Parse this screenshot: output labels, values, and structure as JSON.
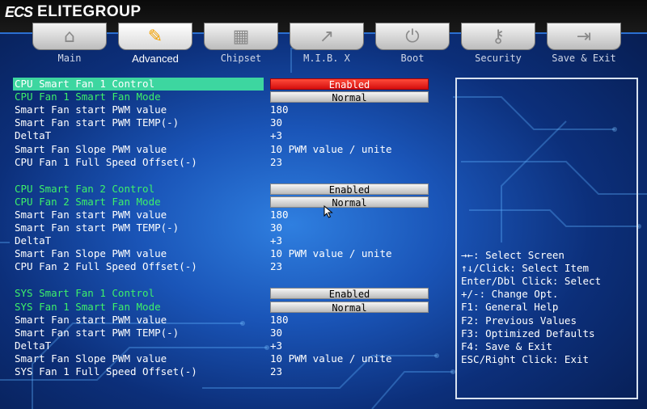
{
  "brand": {
    "logo": "ECS",
    "name": "ELITEGROUP"
  },
  "tabs": [
    {
      "label": "Main",
      "icon": "home-icon",
      "glyph": "⌂",
      "active": false
    },
    {
      "label": "Advanced",
      "icon": "wrench-icon",
      "glyph": "✎",
      "active": true
    },
    {
      "label": "Chipset",
      "icon": "chip-icon",
      "glyph": "▦",
      "active": false
    },
    {
      "label": "M.I.B. X",
      "icon": "chart-icon",
      "glyph": "↗",
      "active": false
    },
    {
      "label": "Boot",
      "icon": "power-icon",
      "glyph": "⏻",
      "active": false
    },
    {
      "label": "Security",
      "icon": "key-icon",
      "glyph": "⚷",
      "active": false
    },
    {
      "label": "Save & Exit",
      "icon": "exit-door-icon",
      "glyph": "⇥",
      "active": false
    }
  ],
  "settings": [
    {
      "label": "CPU Smart Fan 1 Control",
      "value": "Enabled",
      "style": "red-button",
      "color": "white",
      "selected": true
    },
    {
      "label": "CPU Fan 1 Smart Fan Mode",
      "value": "Normal",
      "style": "button",
      "color": "green"
    },
    {
      "label": "Smart Fan start PWM value",
      "value": "180",
      "style": "text",
      "color": "white"
    },
    {
      "label": "Smart Fan start PWM TEMP(-)",
      "value": "30",
      "style": "text",
      "color": "white"
    },
    {
      "label": "DeltaT",
      "value": "+3",
      "style": "text",
      "color": "white"
    },
    {
      "label": "Smart Fan Slope PWM value",
      "value": "10 PWM value / unite",
      "style": "text",
      "color": "white"
    },
    {
      "label": "CPU Fan 1 Full Speed Offset(-)",
      "value": "23",
      "style": "text",
      "color": "white"
    },
    {
      "label": "CPU Smart Fan 2 Control",
      "value": "Enabled",
      "style": "button",
      "color": "green",
      "gap": true
    },
    {
      "label": "CPU Fan 2 Smart Fan Mode",
      "value": "Normal",
      "style": "button",
      "color": "green"
    },
    {
      "label": "Smart Fan start PWM value",
      "value": "180",
      "style": "text",
      "color": "white"
    },
    {
      "label": "Smart Fan start PWM TEMP(-)",
      "value": "30",
      "style": "text",
      "color": "white"
    },
    {
      "label": "DeltaT",
      "value": "+3",
      "style": "text",
      "color": "white"
    },
    {
      "label": "Smart Fan Slope PWM value",
      "value": "10 PWM value / unite",
      "style": "text",
      "color": "white"
    },
    {
      "label": "CPU Fan 2 Full Speed Offset(-)",
      "value": "23",
      "style": "text",
      "color": "white"
    },
    {
      "label": "SYS Smart Fan 1 Control",
      "value": "Enabled",
      "style": "button",
      "color": "green",
      "gap": true
    },
    {
      "label": "SYS Fan 1 Smart Fan Mode",
      "value": "Normal",
      "style": "button",
      "color": "green"
    },
    {
      "label": "Smart Fan start PWM value",
      "value": "180",
      "style": "text",
      "color": "white"
    },
    {
      "label": "Smart Fan start PWM TEMP(-)",
      "value": "30",
      "style": "text",
      "color": "white"
    },
    {
      "label": "DeltaT",
      "value": "+3",
      "style": "text",
      "color": "white"
    },
    {
      "label": "Smart Fan Slope PWM value",
      "value": "10 PWM value / unite",
      "style": "text",
      "color": "white"
    },
    {
      "label": "SYS Fan 1 Full Speed Offset(-)",
      "value": "23",
      "style": "text",
      "color": "white"
    }
  ],
  "help": [
    "→←: Select Screen",
    "↑↓/Click: Select Item",
    "Enter/Dbl Click: Select",
    "+/-: Change Opt.",
    "F1: General Help",
    "F2: Previous Values",
    "F3: Optimized Defaults",
    "F4: Save & Exit",
    "ESC/Right Click: Exit"
  ],
  "colors": {
    "accent_green": "#3df06a",
    "selected_bg": "#3dd6a0",
    "enabled_red": "#e0241a"
  }
}
